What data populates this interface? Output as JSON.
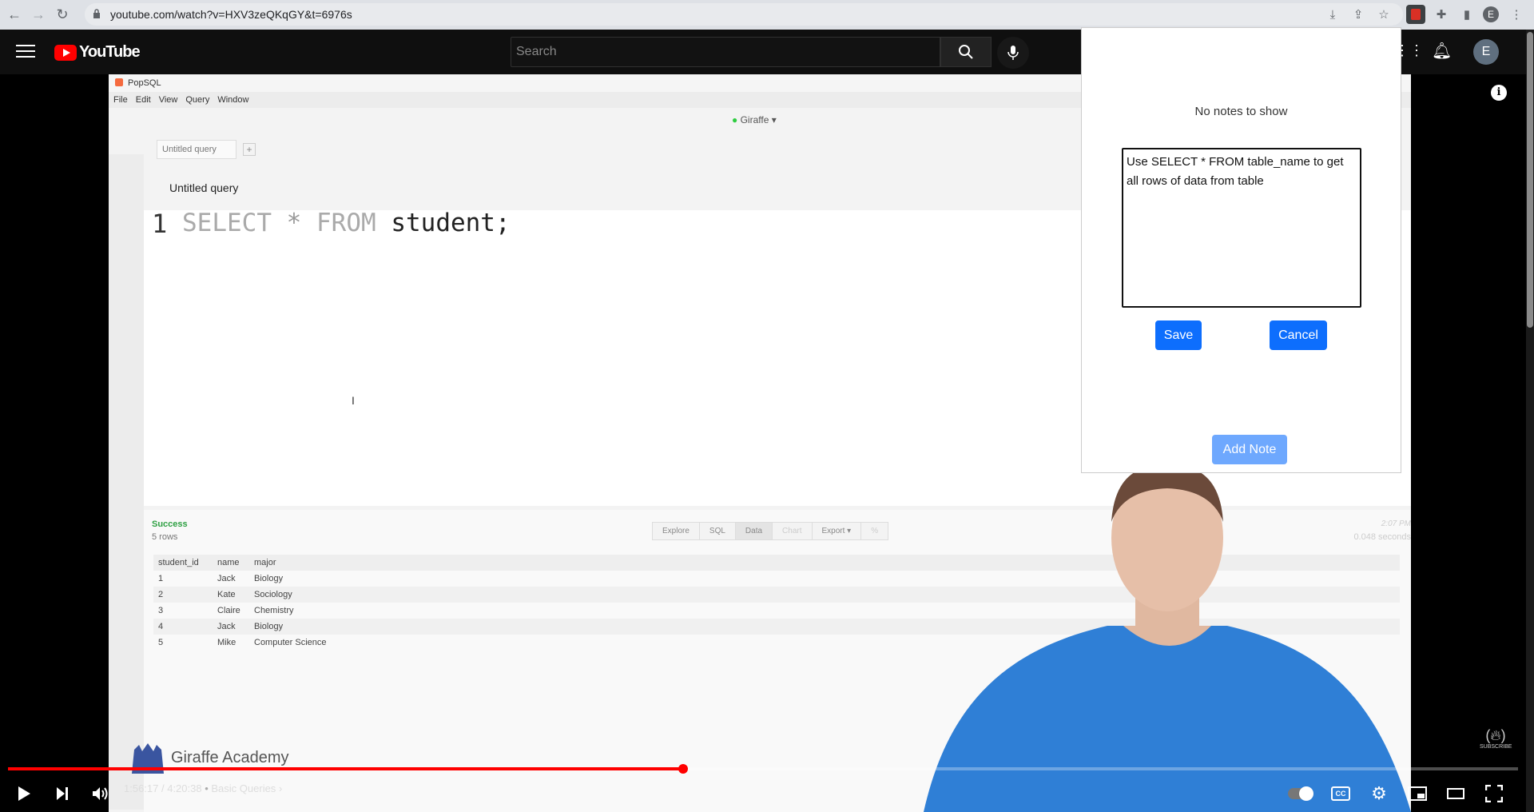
{
  "browser": {
    "url": "youtube.com/watch?v=HXV3zeQKqGY&t=6976s",
    "profile_initial": "E"
  },
  "youtube": {
    "logo_text": "YouTube",
    "search_placeholder": "Search",
    "avatar_initial": "E"
  },
  "video": {
    "app_title": "PopSQL",
    "menu": [
      "File",
      "Edit",
      "View",
      "Query",
      "Window"
    ],
    "connection": "Giraffe",
    "tab_label": "Untitled query",
    "query_title": "Untitled query",
    "line_number": "1",
    "sql": {
      "kw1": "SELECT",
      "star": "*",
      "kw2": "FROM",
      "rest": "student;"
    },
    "status": "Success",
    "row_count": "5 rows",
    "result_tabs": [
      "Explore",
      "SQL",
      "Data",
      "Chart",
      "Export"
    ],
    "run_time": "2:07 PM",
    "duration": "0.048 seconds",
    "columns": [
      "student_id",
      "name",
      "major"
    ],
    "rows": [
      [
        "1",
        "Jack",
        "Biology"
      ],
      [
        "2",
        "Kate",
        "Sociology"
      ],
      [
        "3",
        "Claire",
        "Chemistry"
      ],
      [
        "4",
        "Jack",
        "Biology"
      ],
      [
        "5",
        "Mike",
        "Computer Science"
      ]
    ],
    "watermark": "Giraffe Academy",
    "subscribe": "SUBSCRIBE"
  },
  "notes": {
    "empty_text": "No notes to show",
    "draft": "Use SELECT * FROM table_name to get all rows of data from table",
    "save_label": "Save",
    "cancel_label": "Cancel",
    "add_label": "Add Note",
    "button_color": "#0d6efd"
  },
  "player": {
    "time": "1:56:17 / 4:20:38",
    "chapter": "Basic Queries",
    "progress": 0.447
  }
}
